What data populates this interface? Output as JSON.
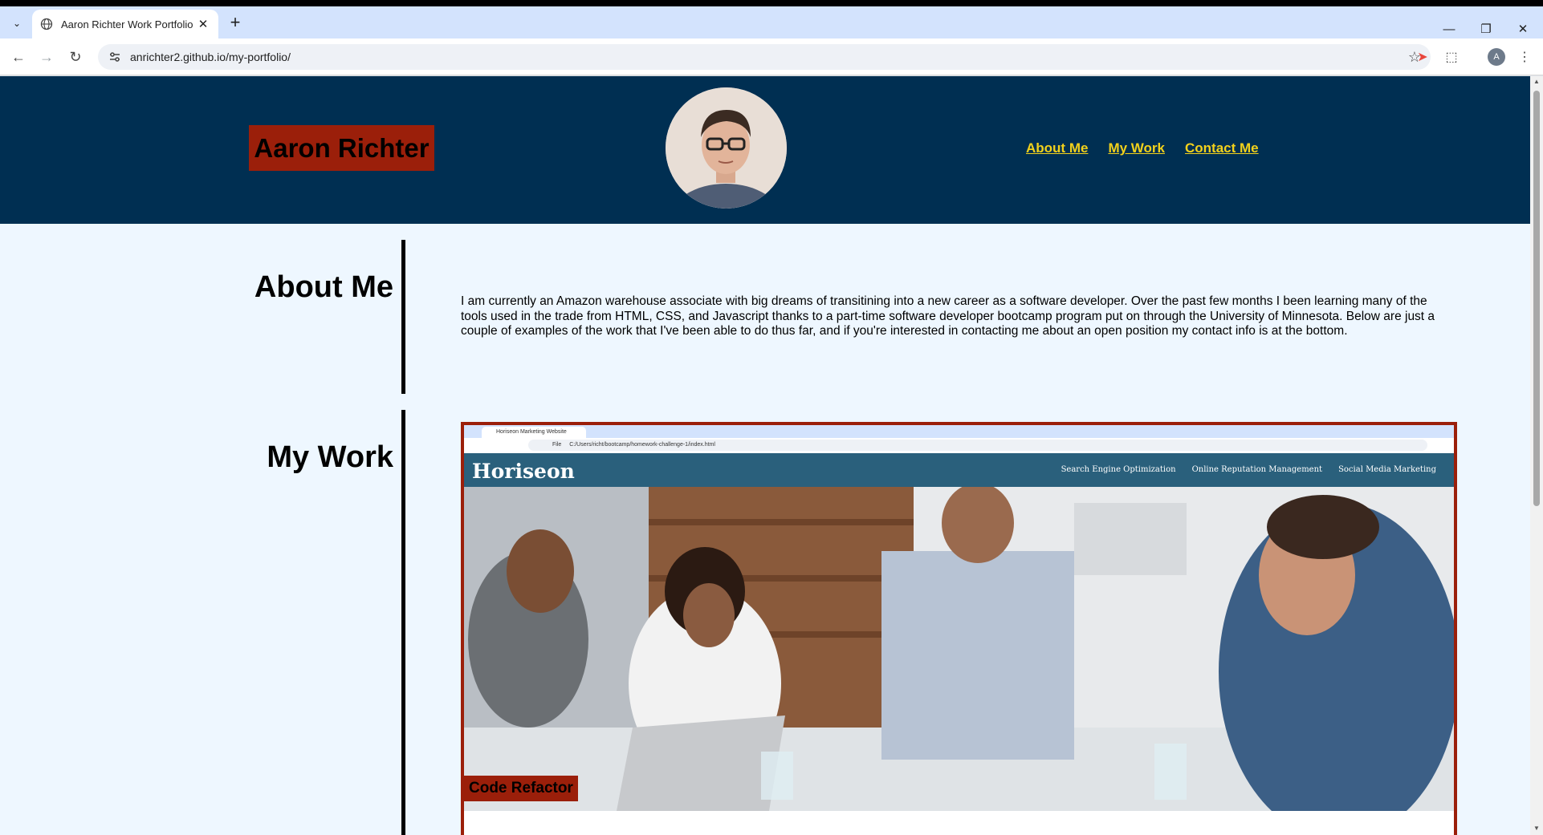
{
  "browser": {
    "tab_title": "Aaron Richter Work Portfolio",
    "url": "anrichter2.github.io/my-portfolio/",
    "avatar_initial": "A"
  },
  "site": {
    "name": "Aaron Richter",
    "nav": [
      "About Me",
      "My Work",
      "Contact Me"
    ],
    "colors": {
      "header_bg": "#002f52",
      "accent": "#9b1f0a",
      "nav_link": "#f2d11b",
      "page_bg": "#eef7ff"
    }
  },
  "about": {
    "heading": "About Me",
    "text": "I am currently an Amazon warehouse associate with big dreams of transitining into a new career as a software developer. Over the past few months I been learning many of the tools used in the trade from HTML, CSS, and Javascript thanks to a part-time software developer bootcamp program put on through the University of Minnesota. Below are just a couple of examples of the work that I've been able to do thus far, and if you're interested in contacting me about an open position my contact info is at the bottom."
  },
  "work": {
    "heading": "My Work",
    "projects": [
      {
        "label": "Code Refactor",
        "preview": {
          "tab_title": "Horiseon Marketing Website",
          "path": "C:/Users/richt/bootcamp/homework-challenge-1/index.html",
          "file_chip": "File",
          "logo": "Horiseon",
          "nav": [
            "Search Engine Optimization",
            "Online Reputation Management",
            "Social Media Marketing"
          ]
        }
      }
    ]
  }
}
